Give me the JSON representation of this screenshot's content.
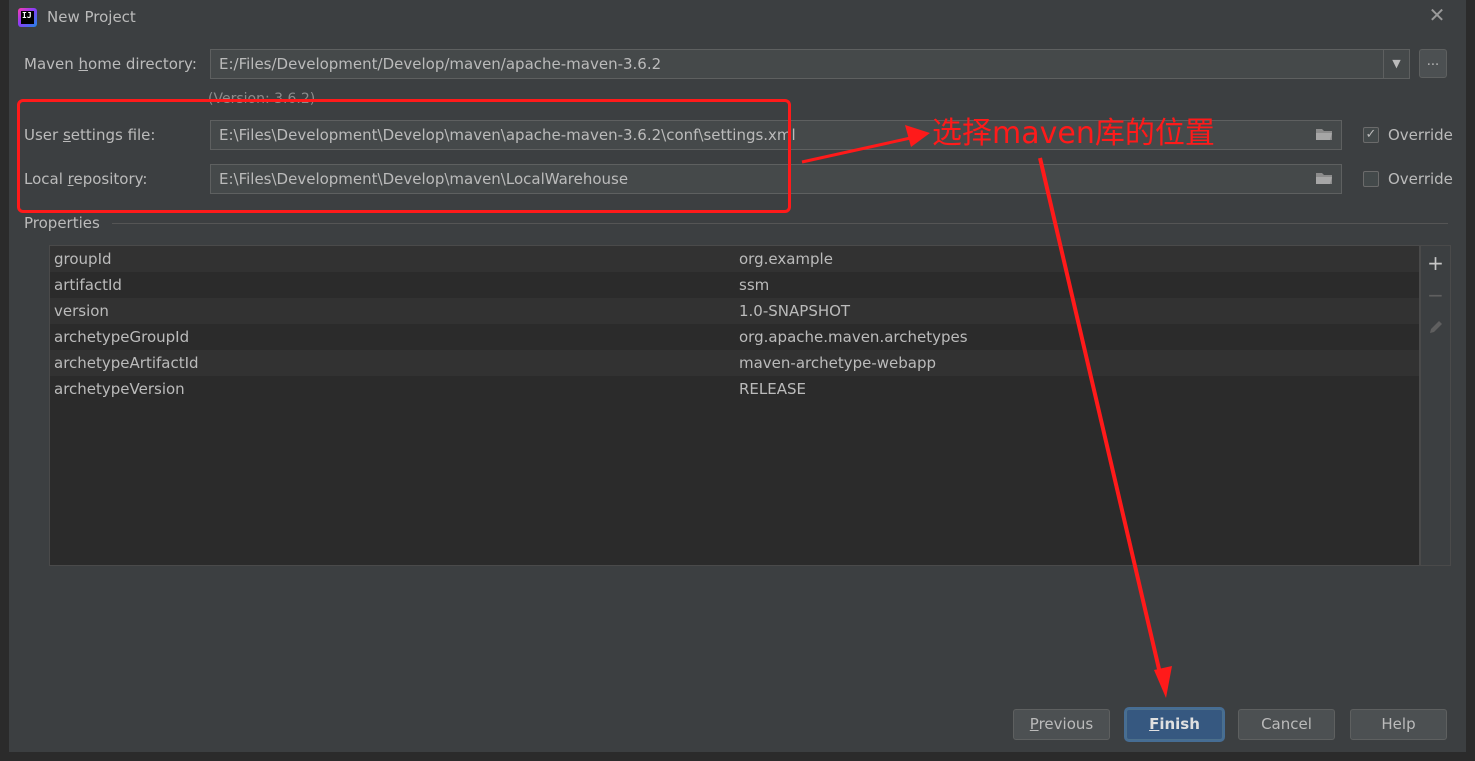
{
  "window": {
    "title": "New Project"
  },
  "maven_home": {
    "label_prefix": "Maven ",
    "label_mnemonic": "h",
    "label_suffix": "ome directory:",
    "value": "E:/Files/Development/Develop/maven/apache-maven-3.6.2",
    "version": "(Version: 3.6.2)",
    "browse_label": "..."
  },
  "user_settings": {
    "label_prefix": "User ",
    "label_mnemonic": "s",
    "label_suffix": "ettings file:",
    "value": "E:\\Files\\Development\\Develop\\maven\\apache-maven-3.6.2\\conf\\settings.xml",
    "override_label": "Override",
    "override_checked": true
  },
  "local_repository": {
    "label_prefix": "Local ",
    "label_mnemonic": "r",
    "label_suffix": "epository:",
    "value": "E:\\Files\\Development\\Develop\\maven\\LocalWarehouse",
    "override_label": "Override",
    "override_checked": false
  },
  "properties": {
    "title": "Properties",
    "rows": [
      {
        "key": "groupId",
        "value": "org.example"
      },
      {
        "key": "artifactId",
        "value": "ssm"
      },
      {
        "key": "version",
        "value": "1.0-SNAPSHOT"
      },
      {
        "key": "archetypeGroupId",
        "value": "org.apache.maven.archetypes"
      },
      {
        "key": "archetypeArtifactId",
        "value": "maven-archetype-webapp"
      },
      {
        "key": "archetypeVersion",
        "value": "RELEASE"
      }
    ],
    "tools": [
      "plus-icon",
      "minus-icon",
      "edit-icon"
    ]
  },
  "buttons": {
    "previous_mnemonic": "P",
    "previous_rest": "revious",
    "finish_mnemonic": "F",
    "finish_rest": "inish",
    "cancel": "Cancel",
    "help": "Help"
  },
  "annotation": {
    "text": "选择maven库的位置",
    "color": "#ff1a1a"
  },
  "colors": {
    "background": "#3c3f41",
    "field": "#45494a",
    "table": "#2b2b2b",
    "primary_button": "#365880"
  }
}
